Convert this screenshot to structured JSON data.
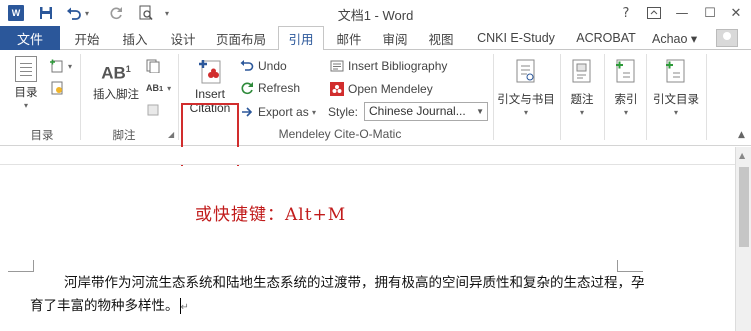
{
  "title_bar": {
    "quick_access": [
      "word-logo",
      "save-icon",
      "undo-icon",
      "redo-icon",
      "print-preview-icon",
      "customize-icon"
    ],
    "window_title": "文档1 - Word",
    "controls": [
      "?",
      "⧉",
      "—",
      "☐",
      "✕"
    ]
  },
  "tabs": {
    "file": "文件",
    "items": [
      "开始",
      "插入",
      "设计",
      "页面布局",
      "引用",
      "邮件",
      "审阅",
      "视图",
      "CNKI E-Study",
      "ACROBAT"
    ],
    "active": "引用",
    "account": "Achao ▾"
  },
  "ribbon": {
    "toc": {
      "button": "目录",
      "group_label": "目录"
    },
    "footnotes": {
      "button_ab": "AB",
      "button": "插入脚注",
      "group_label": "脚注"
    },
    "mendeley": {
      "insert_citation_line1": "Insert",
      "insert_citation_line2": "Citation",
      "undo": "Undo",
      "refresh": "Refresh",
      "export": "Export as",
      "insert_bibliography": "Insert Bibliography",
      "open_mendeley": "Open Mendeley",
      "style_label": "Style:",
      "style_value": "Chinese Journal...",
      "group_label": "Mendeley Cite-O-Matic"
    },
    "citations": {
      "button": "引文与书目"
    },
    "captions": {
      "button": "题注"
    },
    "index": {
      "button": "索引"
    },
    "authorities": {
      "button": "引文目录"
    }
  },
  "document": {
    "shortcut_note": "或快捷键：Alt+M",
    "paragraph": "河岸带作为河流生态系统和陆地生态系统的过渡带，拥有极高的空间异质性和复杂的生态过程，孕育了丰富的物种多样性。",
    "paragraph_mark": "↵"
  },
  "colors": {
    "brand": "#2b579a",
    "highlight_border": "#d12d2d",
    "shortcut_text": "#c11b1b"
  }
}
